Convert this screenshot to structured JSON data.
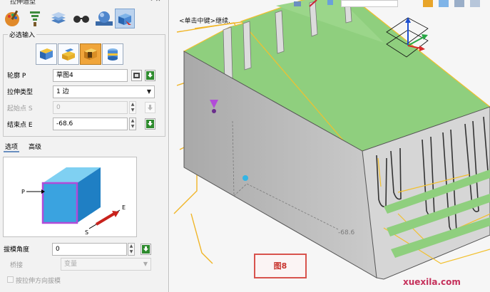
{
  "panel": {
    "title": "拉伸造型",
    "required_section": "必选输入",
    "fields": {
      "profile_label": "轮廓 P",
      "profile_value": "草图4",
      "type_label": "拉伸类型",
      "type_value": "1 边",
      "start_label": "起始点 S",
      "start_value": "0",
      "end_label": "结束点 E",
      "end_value": "-68.6"
    },
    "tabs": [
      "选项",
      "高级"
    ],
    "diagram_labels": {
      "p": "P",
      "e": "E",
      "s": "S"
    },
    "draft_label": "拔模角度",
    "draft_value": "0",
    "bridge_label": "桥接",
    "bridge_value": "变量",
    "draft_dir_label": "按拉伸方向拔模"
  },
  "viewport": {
    "hint": "<单击中键>继续.",
    "figure_label": "图8",
    "dimension": "-68.6",
    "watermark": "xuexila.com"
  },
  "colors": {
    "fin_green": "#8fcf7e",
    "body_gray": "#c2c2c2",
    "preview_orange": "#f0b527",
    "accent_red": "#d8534d"
  }
}
